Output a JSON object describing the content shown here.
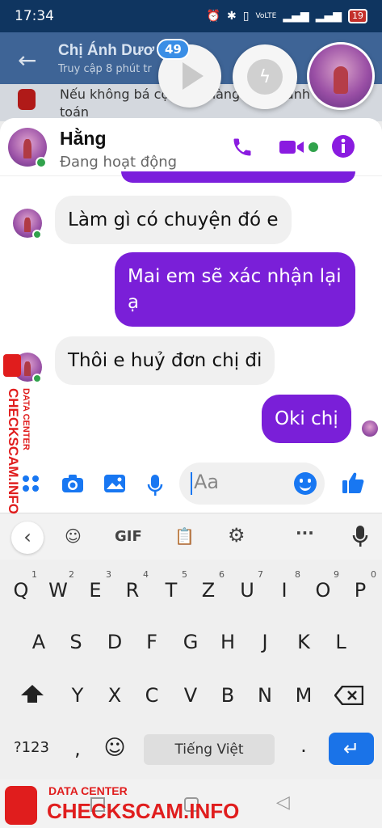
{
  "status_bar": {
    "time": "17:34",
    "icons": [
      "alarm-icon",
      "bluetooth-icon",
      "vibrate-icon",
      "volte-icon",
      "signal-icon",
      "signal-icon",
      "battery-icon"
    ],
    "battery": "19"
  },
  "background_chat": {
    "name": "Chị Ánh Dươ",
    "sub": "Truy cập 8 phút tr",
    "preview": "Nếu không bá                      cọc còn hàng đến thanh toán"
  },
  "chat_heads": {
    "badge": "49"
  },
  "chat": {
    "contact_name": "Hằng",
    "status": "Đang hoạt động",
    "accent_color": "#7a1fd8",
    "messages": [
      {
        "dir": "in",
        "text": "Làm gì có chuyện đó e"
      },
      {
        "dir": "out",
        "text": "Mai em sẽ xác nhận lại ạ"
      },
      {
        "dir": "in",
        "text": "Thôi e huỷ đơn chị đi"
      },
      {
        "dir": "out",
        "text": "Oki chị"
      }
    ]
  },
  "composer": {
    "placeholder": "Aa"
  },
  "keyboard": {
    "toolbar": [
      "back-icon",
      "sticker-icon",
      "GIF",
      "clipboard-icon",
      "settings-icon",
      "more-icon",
      "mic-icon"
    ],
    "gif_label": "GIF",
    "row1": [
      "Q",
      "W",
      "E",
      "R",
      "T",
      "Z",
      "U",
      "I",
      "O",
      "P"
    ],
    "row1_hints": [
      "1",
      "2",
      "3",
      "4",
      "5",
      "6",
      "7",
      "8",
      "9",
      "0"
    ],
    "row2": [
      "A",
      "S",
      "D",
      "F",
      "G",
      "H",
      "J",
      "K",
      "L"
    ],
    "row3": [
      "Y",
      "X",
      "C",
      "V",
      "B",
      "N",
      "M"
    ],
    "num_key": "?123",
    "comma": ",",
    "space_label": "Tiếng Việt",
    "period": "."
  },
  "watermark": {
    "label": "DATA CENTER",
    "site": "CHECKSCAM.INFO"
  }
}
